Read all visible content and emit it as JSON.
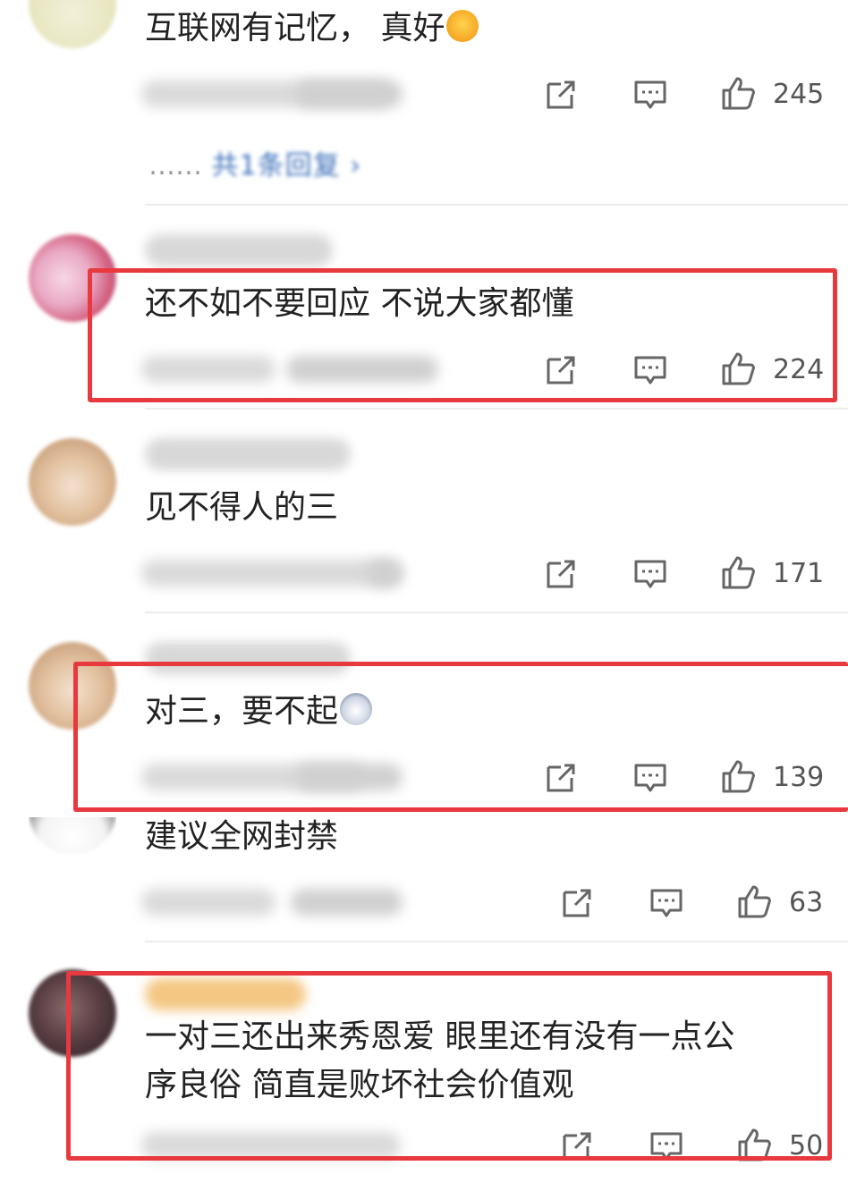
{
  "comments": [
    {
      "text": "互联网有记忆，  真好",
      "likes": "245",
      "replies": {
        "dots": "……",
        "label": "共1条回复 ›"
      }
    },
    {
      "text": "还不如不要回应 不说大家都懂",
      "likes": "224"
    },
    {
      "text": "见不得人的三",
      "likes": "171"
    },
    {
      "text": "对三，要不起",
      "likes": "139"
    },
    {
      "text": "建议全网封禁",
      "likes": "63"
    },
    {
      "text_line1": "一对三还出来秀恩爱 眼里还有没有一点公",
      "text_line2": "序良俗  简直是败坏社会价值观",
      "likes": "50"
    }
  ],
  "colors": {
    "highlight": "#e8393f",
    "reply_link": "#3a6fb8"
  },
  "icons": [
    "share-icon",
    "comment-icon",
    "like-icon"
  ]
}
